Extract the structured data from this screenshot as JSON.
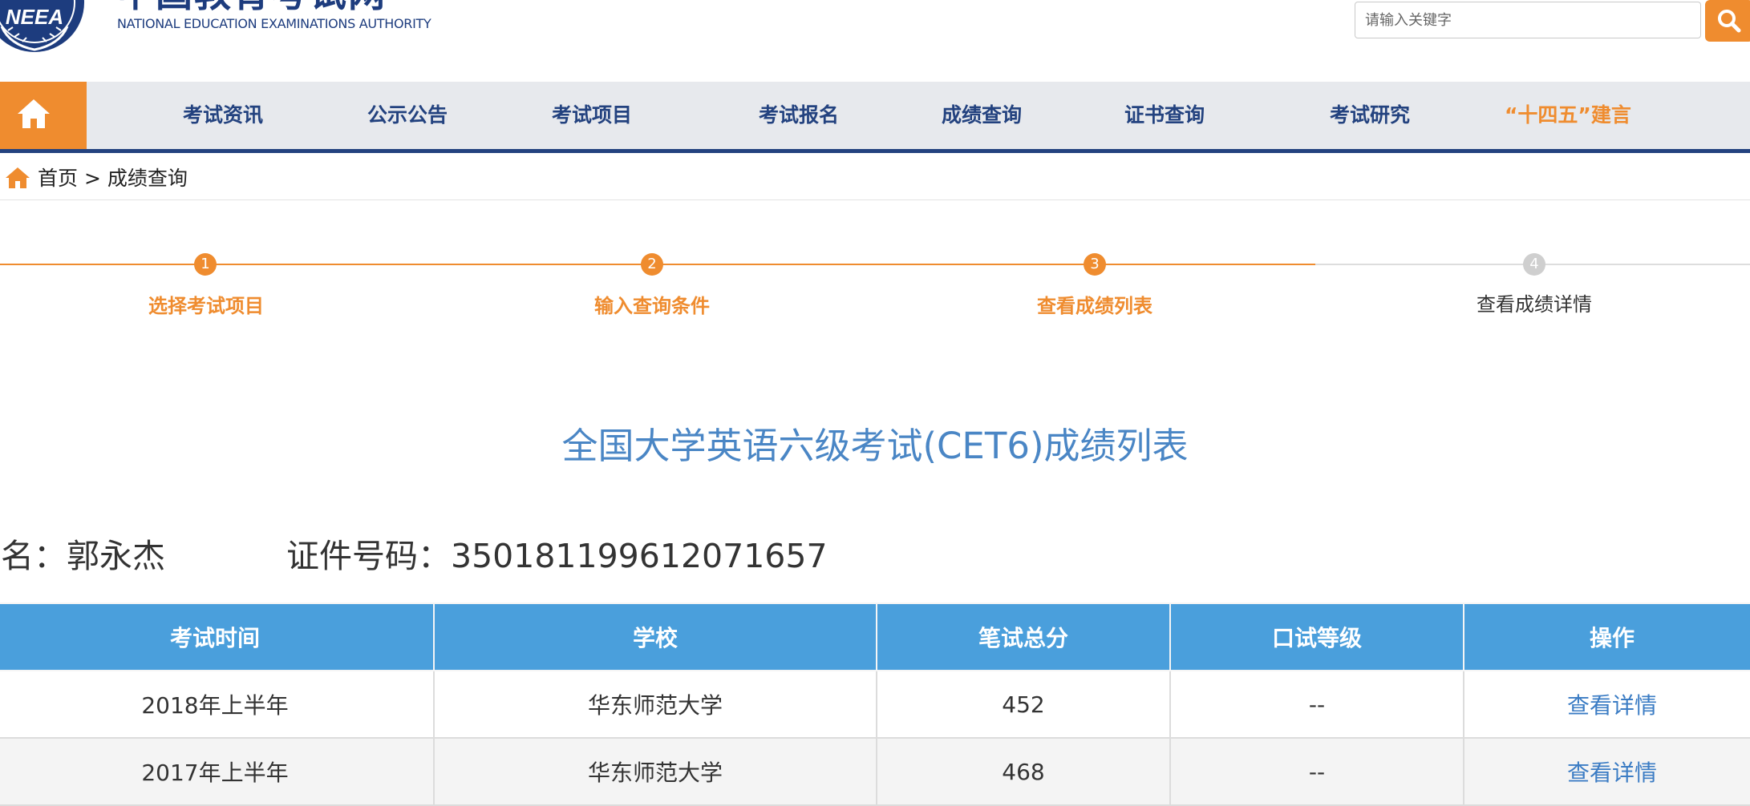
{
  "header": {
    "logo_seal_text": "NEEA",
    "logo_cn": "中国教育考试网",
    "logo_en": "NATIONAL EDUCATION EXAMINATIONS AUTHORITY",
    "search_placeholder": "请输入关键字"
  },
  "nav": {
    "items": [
      "考试资讯",
      "公示公告",
      "考试项目",
      "考试报名",
      "成绩查询",
      "证书查询",
      "考试研究",
      "“十四五”建言"
    ]
  },
  "breadcrumb": {
    "home": "首页",
    "separator": ">",
    "current": "成绩查询"
  },
  "steps": [
    {
      "number": "1",
      "label": "选择考试项目",
      "state": "active"
    },
    {
      "number": "2",
      "label": "输入查询条件",
      "state": "active"
    },
    {
      "number": "3",
      "label": "查看成绩列表",
      "state": "active"
    },
    {
      "number": "4",
      "label": "查看成绩详情",
      "state": "inactive"
    }
  ],
  "result": {
    "title": "全国大学英语六级考试(CET6)成绩列表",
    "name_label": "姓名：",
    "name_value": "郭永杰",
    "id_label": "证件号码：",
    "id_value": "350181199612071657"
  },
  "table": {
    "headers": [
      "考试时间",
      "学校",
      "笔试总分",
      "口试等级",
      "操作"
    ],
    "rows": [
      {
        "time": "2018年上半年",
        "school": "华东师范大学",
        "score": "452",
        "oral": "--",
        "action": "查看详情"
      },
      {
        "time": "2017年上半年",
        "school": "华东师范大学",
        "score": "468",
        "oral": "--",
        "action": "查看详情"
      }
    ]
  },
  "colors": {
    "brand_orange": "#ef8c2f",
    "brand_navy": "#23427f",
    "title_blue": "#4a86c5",
    "table_header_blue": "#4a9fdc",
    "link_blue": "#3b7cc4"
  }
}
